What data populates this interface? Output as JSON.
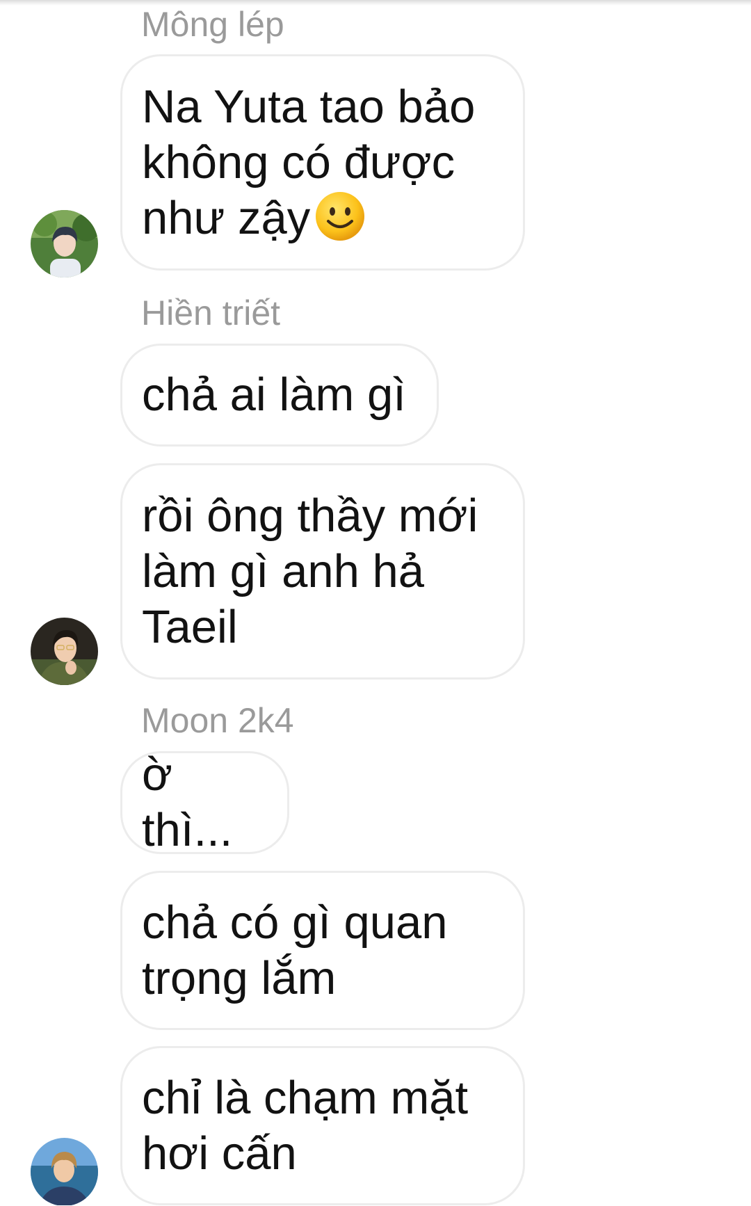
{
  "conversation": {
    "groups": [
      {
        "sender": "Mông lép",
        "avatar_icon": "user-avatar-icon",
        "messages": [
          {
            "text": "Na Yuta tao bảo không có được như zậy",
            "emoji": "slightly-smiling-face-icon"
          }
        ]
      },
      {
        "sender": "Hiền triết",
        "avatar_icon": "user-avatar-icon",
        "messages": [
          {
            "text": "chả ai làm gì"
          },
          {
            "text": "rồi ông thầy mới làm gì anh hả Taeil"
          }
        ]
      },
      {
        "sender": "Moon 2k4",
        "avatar_icon": "user-avatar-icon",
        "messages": [
          {
            "text": "ờ thì..."
          },
          {
            "text": "chả có gì quan trọng lắm"
          },
          {
            "text": "chỉ là chạm mặt hơi cấn"
          }
        ]
      }
    ]
  }
}
